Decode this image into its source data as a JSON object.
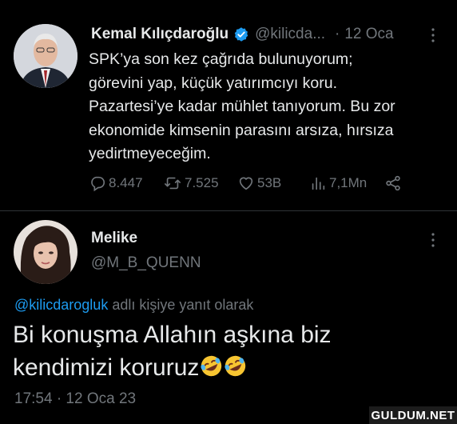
{
  "tweet": {
    "author_name": "Kemal Kılıçdaroğlu",
    "handle": "@kilicda...",
    "separator": "·",
    "date": "12 Oca",
    "text_lines": [
      "SPK’ya son kez çağrıda bulunuyorum;",
      "görevini yap, küçük yatırımcıyı koru.",
      "Pazartesi’ye kadar mühlet tanıyorum. Bu zor",
      "ekonomide kimsenin parasını arsıza, hırsıza",
      "yedirtmeyeceğim."
    ],
    "stats": {
      "replies": "8.447",
      "retweets": "7.525",
      "likes": "53B",
      "views": "7,1Mn"
    },
    "icons": [
      "verified-badge-icon",
      "more-icon",
      "reply-icon",
      "retweet-icon",
      "like-icon",
      "views-icon",
      "share-icon"
    ]
  },
  "reply": {
    "author_name": "Melike",
    "handle": "@M_B_QUENN",
    "reply_to_handle": "@kilicdarogluk",
    "reply_to_suffix": " adlı kişiye yanıt olarak",
    "text_line1": "Bi konuşma Allahın aşkına biz",
    "text_line2": "kendimizi koruruz",
    "emojis": [
      "rolling-on-floor-laughing-emoji",
      "rolling-on-floor-laughing-emoji"
    ],
    "timestamp": "17:54 · 12 Oca 23"
  },
  "watermark": "GULDUM.NET",
  "colors": {
    "background": "#000000",
    "text": "#e7e9ea",
    "secondary_text": "#71767b",
    "link": "#1d9bf0",
    "verified": "#1d9bf0"
  }
}
